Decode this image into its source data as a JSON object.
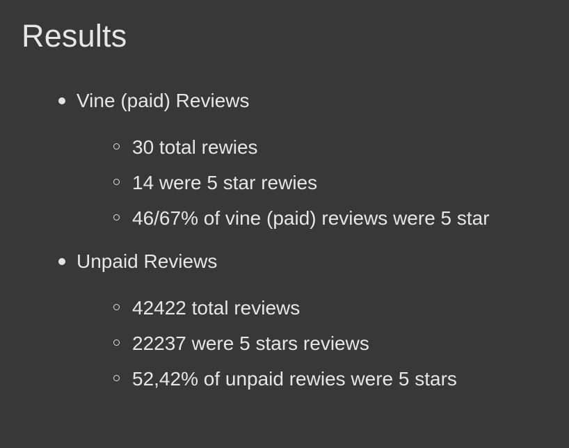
{
  "heading": "Results",
  "sections": [
    {
      "label": "Vine (paid) Reviews",
      "items": [
        "30 total rewies",
        "14 were 5 star rewies",
        "46/67% of vine (paid) reviews were 5 star"
      ]
    },
    {
      "label": "Unpaid Reviews",
      "items": [
        "42422 total reviews",
        "22237 were 5 stars reviews",
        "52,42% of unpaid rewies were 5 stars"
      ]
    }
  ],
  "colors": {
    "background": "#383838",
    "text": "#e6e6e6"
  },
  "icons": {
    "level1_bullet": "filled-disc-bullet",
    "level2_bullet": "hollow-circle-bullet"
  }
}
